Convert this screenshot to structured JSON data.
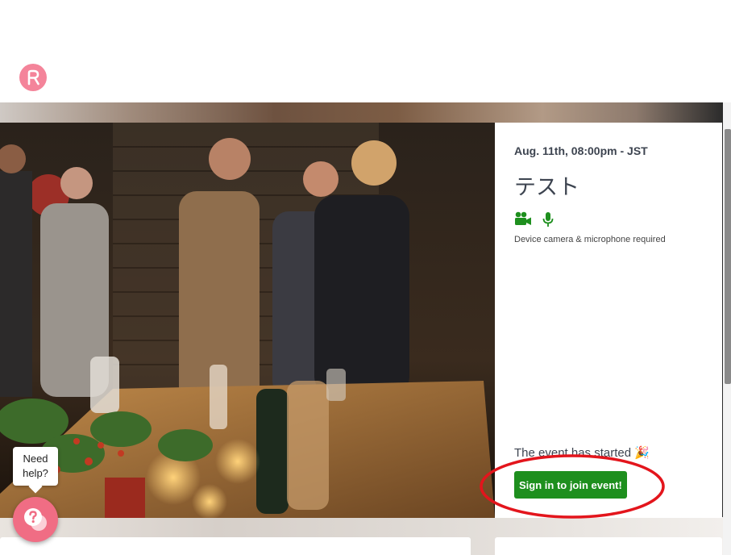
{
  "header": {
    "logo_icon": "rabbit-r-logo"
  },
  "event": {
    "date": "Aug. 11th, 08:00pm - JST",
    "title": "テスト",
    "device_icons": [
      "video-camera-icon",
      "microphone-icon"
    ],
    "device_note": "Device camera & microphone required",
    "status_text": "The event has started",
    "status_emoji": "🎉",
    "join_label": "Sign in to join event!"
  },
  "help": {
    "bubble_line1": "Need",
    "bubble_line2": "help?",
    "icon": "question-chat-icon"
  },
  "colors": {
    "brand": "#f4849a",
    "join_button": "#1e8f1e",
    "icon_green": "#1e8f1e",
    "annotation_red": "#e3151c",
    "help_button": "#f06d84"
  }
}
